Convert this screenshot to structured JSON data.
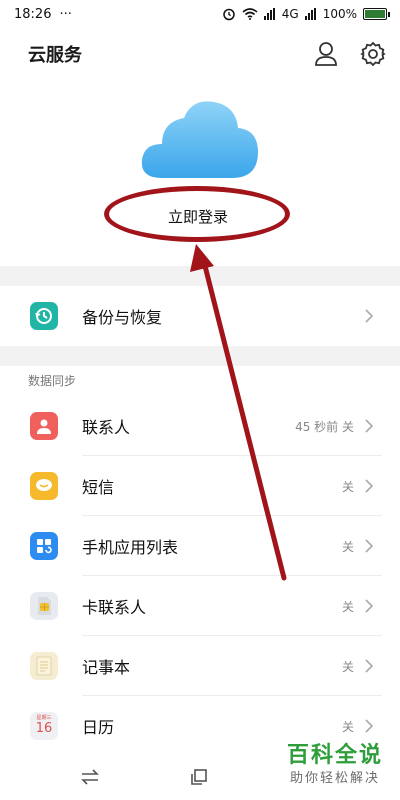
{
  "status_bar": {
    "time": "18:26",
    "dots": "···",
    "network": "4G",
    "battery": "100%"
  },
  "header": {
    "title": "云服务",
    "icons": [
      "person-icon",
      "gear-icon"
    ]
  },
  "login": {
    "label": "立即登录"
  },
  "backup": {
    "label": "备份与恢复",
    "color": "#20b5a5"
  },
  "sync_section": {
    "title": "数据同步",
    "items": [
      {
        "label": "联系人",
        "status": "45 秒前  关",
        "icon": "contacts-icon",
        "color": "#f0605d"
      },
      {
        "label": "短信",
        "status": "关",
        "icon": "message-icon",
        "color": "#f6b92b"
      },
      {
        "label": "手机应用列表",
        "status": "关",
        "icon": "app-list-icon",
        "color": "#2d8cf0"
      },
      {
        "label": "卡联系人",
        "status": "关",
        "icon": "sim-card-icon",
        "color": "#e7ebf0"
      },
      {
        "label": "记事本",
        "status": "关",
        "icon": "notepad-icon",
        "color": "#f5ecd2"
      },
      {
        "label": "日历",
        "status": "关",
        "icon": "calendar-icon",
        "color": "#eef0f3"
      }
    ]
  },
  "calendar_icon": {
    "month": "星期三",
    "day": "16"
  },
  "watermark": {
    "main": "百科全说",
    "sub": "助你轻松解决"
  },
  "colors": {
    "annotation": "#a0141a",
    "cloud": "#5cb8ef"
  }
}
